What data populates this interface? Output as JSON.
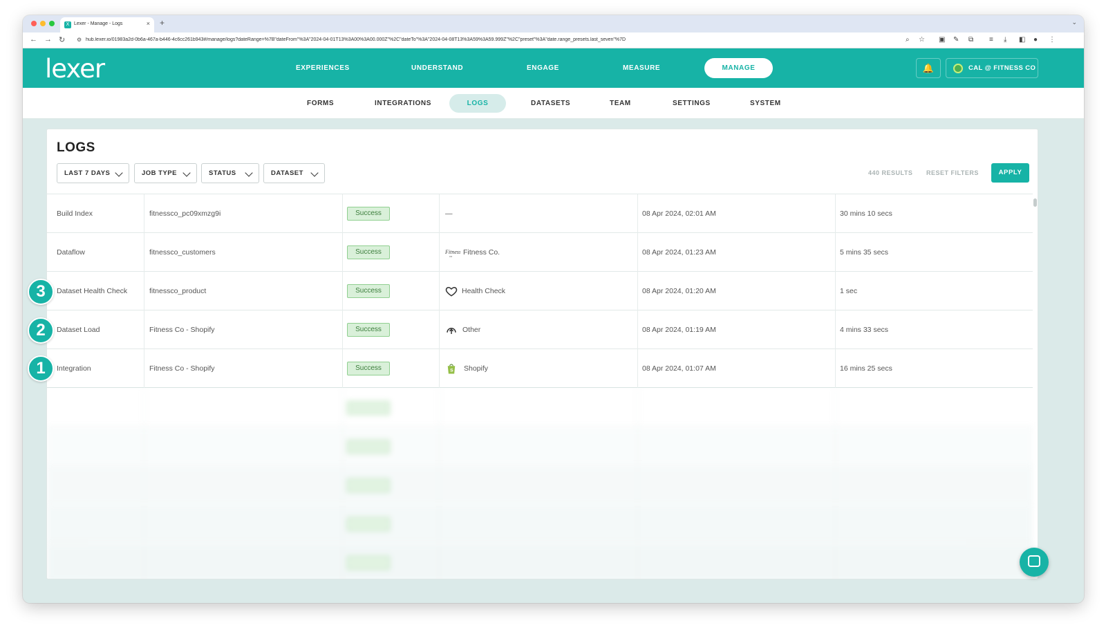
{
  "browser": {
    "tab_title": "Lexer - Manage - Logs",
    "favicon": "X",
    "close_glyph": "×",
    "new_tab_glyph": "+",
    "tab_menu_glyph": "⌄",
    "url": "hub.lexer.io/01983a2d-0b6a-467a-b446-4c6cc261b943#/manage/logs?dateRange=%7B\"dateFrom\"%3A\"2024-04-01T13%3A00%3A00.000Z\"%2C\"dateTo\"%3A\"2024-04-08T13%3A59%3A59.999Z\"%2C\"preset\"%3A\"date.range_presets.last_seven\"%7D",
    "icons": [
      "back-icon",
      "forward-icon",
      "reload-icon",
      "site-info-icon",
      "zoom-icon",
      "bookmark-star-icon",
      "extension-icon",
      "download-icon",
      "menu-icon"
    ]
  },
  "brand": {
    "logo": "lexer",
    "color": "#17b3a6"
  },
  "main_nav": {
    "items": [
      "EXPERIENCES",
      "UNDERSTAND",
      "ENGAGE",
      "MEASURE"
    ],
    "active": "MANAGE"
  },
  "header": {
    "bell_glyph": "🔔",
    "account_label": "CAL @ FITNESS CO"
  },
  "sub_nav": {
    "items": [
      "FORMS",
      "INTEGRATIONS",
      "DATASETS",
      "TEAM",
      "SETTINGS",
      "SYSTEM"
    ],
    "active": "LOGS"
  },
  "page": {
    "title": "LOGS"
  },
  "filters": [
    {
      "label": "LAST 7 DAYS"
    },
    {
      "label": "JOB TYPE"
    },
    {
      "label": "STATUS"
    },
    {
      "label": "DATASET"
    }
  ],
  "results_label": "440 RESULTS",
  "reset_label": "RESET FILTERS",
  "apply_label": "APPLY",
  "rows": [
    {
      "job": "Build Index",
      "name": "fitnessco_pc09xmzg9i",
      "status": "Success",
      "source": "—",
      "source_icon": "none",
      "date": "08 Apr 2024, 02:01 AM",
      "duration": "30 mins 10 secs"
    },
    {
      "job": "Dataflow",
      "name": "fitnessco_customers",
      "status": "Success",
      "source": "Fitness Co.",
      "source_icon": "fitness-co-logo-icon",
      "date": "08 Apr 2024, 01:23 AM",
      "duration": "5 mins 35 secs"
    },
    {
      "job": "Dataset Health Check",
      "name": "fitnessco_product",
      "status": "Success",
      "source": "Health Check",
      "source_icon": "heart-icon",
      "date": "08 Apr 2024, 01:20 AM",
      "duration": "1 sec"
    },
    {
      "job": "Dataset Load",
      "name": "Fitness Co - Shopify",
      "status": "Success",
      "source": "Other",
      "source_icon": "upload-cloud-icon",
      "date": "08 Apr 2024, 01:19 AM",
      "duration": "4 mins 33 secs"
    },
    {
      "job": "Integration",
      "name": "Fitness Co - Shopify",
      "status": "Success",
      "source": "Shopify",
      "source_icon": "shopify-bag-icon",
      "date": "08 Apr 2024, 01:07 AM",
      "duration": "16 mins 25 secs"
    }
  ],
  "step_markers": [
    "3",
    "2",
    "1"
  ],
  "status_colors": {
    "success_bg": "#d9f0d9",
    "success_border": "#8fcf8f",
    "success_text": "#3b7d3b"
  }
}
